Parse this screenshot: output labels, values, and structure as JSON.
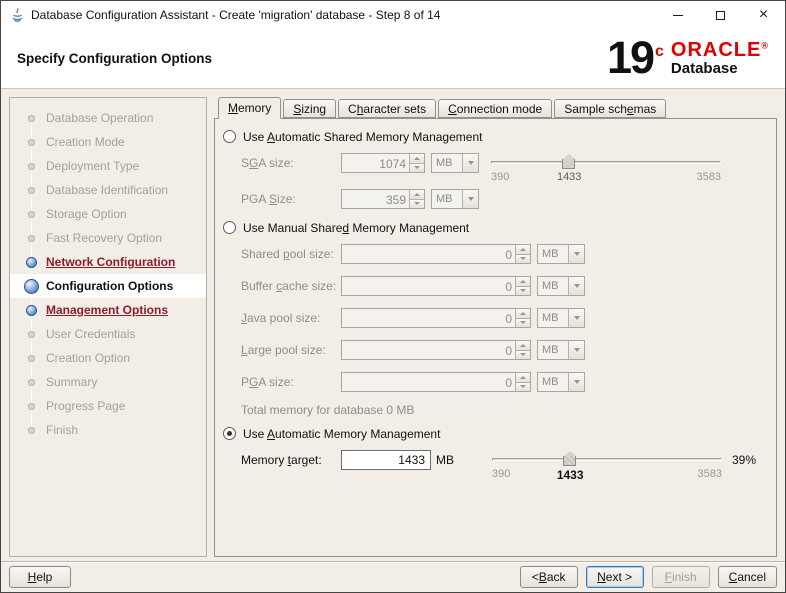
{
  "window": {
    "title": "Database Configuration Assistant - Create 'migration' database - Step 8 of 14"
  },
  "header": {
    "title": "Specify Configuration Options",
    "logo": {
      "big": "19",
      "sup": "c",
      "brand": "ORACLE",
      "reg": "®",
      "product": "Database"
    }
  },
  "sidebar": {
    "steps": [
      {
        "label": "Database Operation",
        "state": "pending"
      },
      {
        "label": "Creation Mode",
        "state": "pending"
      },
      {
        "label": "Deployment Type",
        "state": "pending"
      },
      {
        "label": "Database Identification",
        "state": "pending"
      },
      {
        "label": "Storage Option",
        "state": "pending"
      },
      {
        "label": "Fast Recovery Option",
        "state": "pending"
      },
      {
        "label": "Network Configuration",
        "state": "visited"
      },
      {
        "label": "Configuration Options",
        "state": "current"
      },
      {
        "label": "Management Options",
        "state": "visited"
      },
      {
        "label": "User Credentials",
        "state": "pending"
      },
      {
        "label": "Creation Option",
        "state": "pending"
      },
      {
        "label": "Summary",
        "state": "pending"
      },
      {
        "label": "Progress Page",
        "state": "pending"
      },
      {
        "label": "Finish",
        "state": "pending"
      }
    ]
  },
  "tabs": [
    {
      "label": "Memory",
      "mn": 0,
      "selected": true
    },
    {
      "label": "Sizing",
      "mn": 0,
      "selected": false
    },
    {
      "label": "Character sets",
      "mn": 1,
      "selected": false
    },
    {
      "label": "Connection mode",
      "mn": 0,
      "selected": false
    },
    {
      "label": "Sample schemas",
      "mn": 10,
      "selected": false
    }
  ],
  "memory_tab": {
    "asmm": {
      "radio": {
        "label": "Use Automatic Shared Memory Management",
        "mn": 4,
        "selected": false
      },
      "sga": {
        "label": "SGA size:",
        "mn": 1,
        "value": "1074",
        "unit": "MB"
      },
      "pga": {
        "label": "PGA Size:",
        "mn": 4,
        "value": "359",
        "unit": "MB"
      },
      "slider": {
        "min_label": "390",
        "value_label": "1433",
        "max_label": "3583",
        "percent": 34
      }
    },
    "msmm": {
      "radio": {
        "label": "Use Manual Shared Memory Management",
        "mn": 16,
        "selected": false
      },
      "rows": [
        {
          "label": "Shared pool size:",
          "mn": 7,
          "value": "0",
          "unit": "MB"
        },
        {
          "label": "Buffer cache size:",
          "mn": 7,
          "value": "0",
          "unit": "MB"
        },
        {
          "label": "Java pool size:",
          "mn": 0,
          "value": "0",
          "unit": "MB"
        },
        {
          "label": "Large pool size:",
          "mn": 0,
          "value": "0",
          "unit": "MB"
        },
        {
          "label": "PGA size:",
          "mn": 1,
          "value": "0",
          "unit": "MB"
        }
      ],
      "total": "Total memory for database 0 MB"
    },
    "amm": {
      "radio": {
        "label": "Use Automatic Memory Management",
        "mn": 4,
        "selected": true
      },
      "target": {
        "label": "Memory target:",
        "mn": 7,
        "value": "1433",
        "unit": "MB"
      },
      "slider": {
        "min_label": "390",
        "value_label": "1433",
        "max_label": "3583",
        "percent": 34,
        "percent_label": "39%"
      }
    }
  },
  "footer": {
    "help": {
      "label": "Help",
      "mn": 0
    },
    "back": {
      "label": "< Back",
      "mn": 2
    },
    "next": {
      "label": "Next >",
      "mn": 0
    },
    "finish": {
      "label": "Finish",
      "mn": 0
    },
    "cancel": {
      "label": "Cancel",
      "mn": 0
    }
  }
}
